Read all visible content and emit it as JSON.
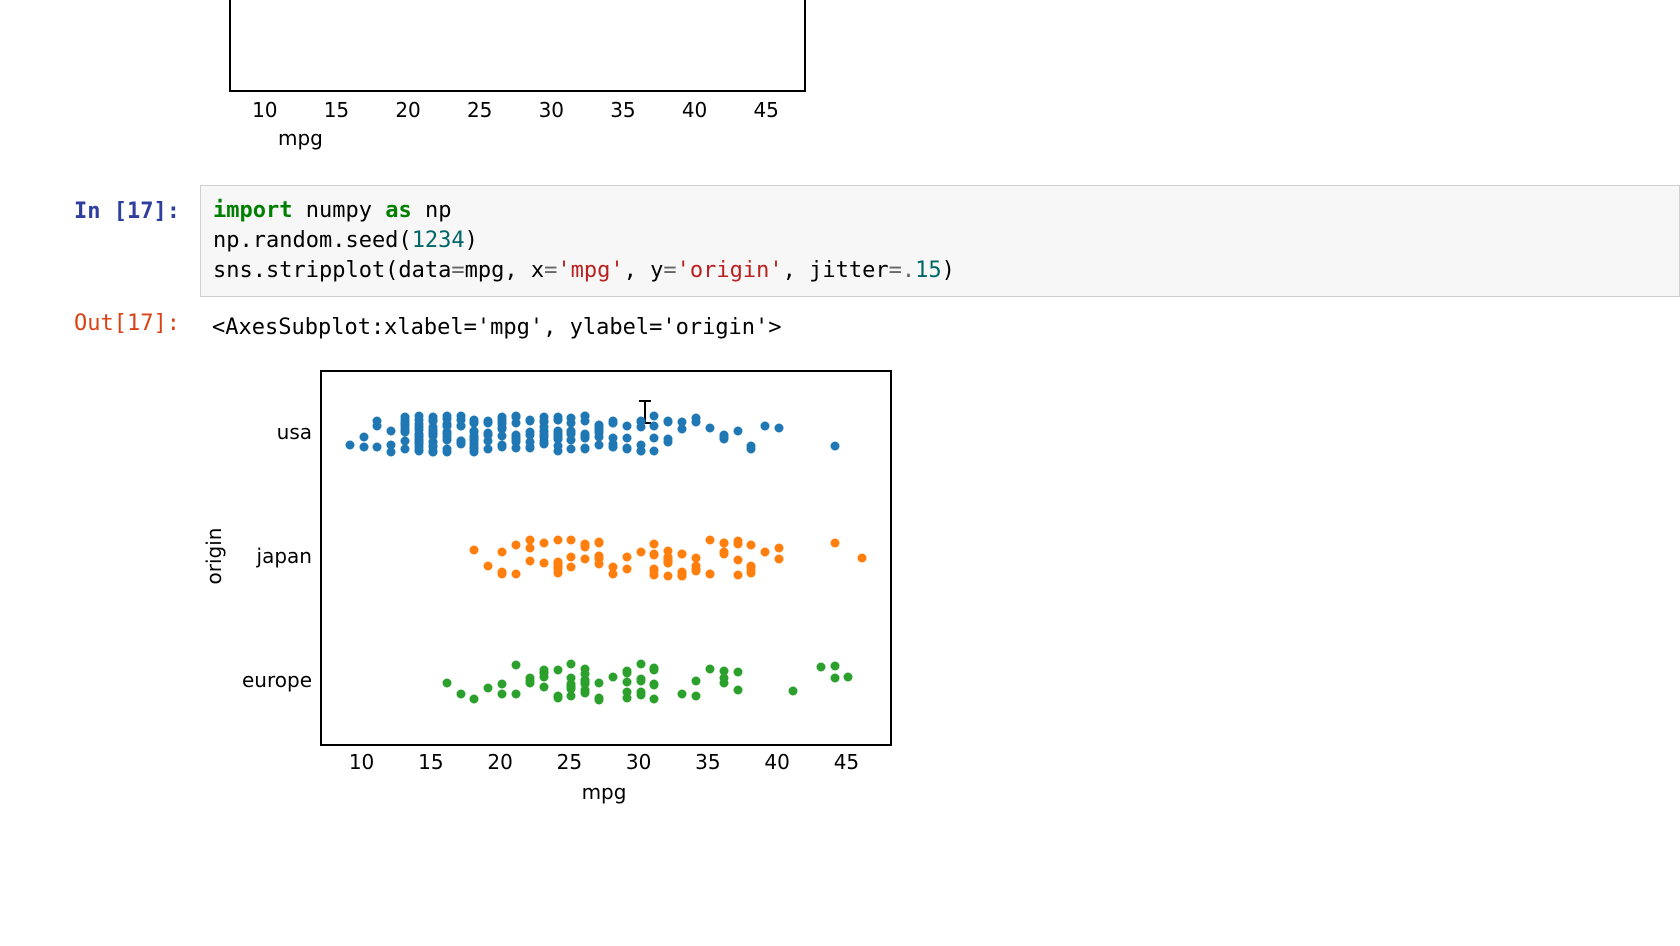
{
  "top_axis": {
    "xlabel": "mpg",
    "xticks": [
      10,
      15,
      20,
      25,
      30,
      35,
      40,
      45
    ]
  },
  "cell": {
    "in_prompt": "In [17]:",
    "out_prompt": "Out[17]:",
    "code_tokens": [
      {
        "t": "import ",
        "c": "k-green"
      },
      {
        "t": "numpy ",
        "c": ""
      },
      {
        "t": "as ",
        "c": "k-green"
      },
      {
        "t": "np",
        "c": ""
      },
      {
        "t": "\n",
        "c": ""
      },
      {
        "t": "np.random.seed(",
        "c": ""
      },
      {
        "t": "1234",
        "c": "k-num"
      },
      {
        "t": ")",
        "c": ""
      },
      {
        "t": "\n",
        "c": ""
      },
      {
        "t": "sns.stripplot(data",
        "c": ""
      },
      {
        "t": "=",
        "c": "k-op"
      },
      {
        "t": "mpg, x",
        "c": ""
      },
      {
        "t": "=",
        "c": "k-op"
      },
      {
        "t": "'mpg'",
        "c": "k-str"
      },
      {
        "t": ", y",
        "c": ""
      },
      {
        "t": "=",
        "c": "k-op"
      },
      {
        "t": "'origin'",
        "c": "k-str"
      },
      {
        "t": ", jitter",
        "c": ""
      },
      {
        "t": "=.",
        "c": "k-op"
      },
      {
        "t": "15",
        "c": "k-num"
      },
      {
        "t": ")",
        "c": ""
      }
    ],
    "out_text": "<AxesSubplot:xlabel='mpg', ylabel='origin'>"
  },
  "chart_data": {
    "type": "strip",
    "xlabel": "mpg",
    "ylabel": "origin",
    "xlim": [
      7,
      48
    ],
    "xticks": [
      10,
      15,
      20,
      25,
      30,
      35,
      40,
      45
    ],
    "categories": [
      "usa",
      "japan",
      "europe"
    ],
    "colors": {
      "usa": "#1f77b4",
      "japan": "#ff7f0e",
      "europe": "#2ca02c"
    },
    "jitter": 0.15,
    "series": [
      {
        "name": "usa",
        "values": [
          18,
          15,
          18,
          16,
          17,
          15,
          14,
          14,
          14,
          15,
          15,
          14,
          15,
          14,
          24,
          22,
          18,
          21,
          27,
          26,
          25,
          24,
          25,
          26,
          21,
          10,
          10,
          11,
          9,
          27,
          28,
          25,
          19,
          16,
          17,
          19,
          18,
          14,
          14,
          14,
          14,
          12,
          13,
          13,
          18,
          22,
          19,
          18,
          23,
          28,
          30,
          30,
          31,
          35,
          27,
          26,
          24,
          25,
          23,
          20,
          21,
          13,
          14,
          15,
          14,
          17,
          11,
          13,
          12,
          13,
          19,
          15,
          13,
          13,
          14,
          18,
          22,
          21,
          26,
          15,
          16,
          29,
          24,
          20,
          19,
          15,
          24,
          20,
          11,
          20,
          19,
          15,
          31,
          26,
          32,
          28,
          24,
          26,
          24,
          26,
          31,
          29,
          24,
          23,
          38,
          36,
          36,
          36,
          34,
          32,
          28,
          26,
          22,
          32,
          28,
          24,
          26,
          22,
          28,
          27,
          13,
          14,
          13,
          14,
          15,
          12,
          13,
          16,
          18,
          18,
          23,
          26,
          22,
          28,
          17,
          21,
          14,
          13,
          15,
          16,
          18,
          21,
          21,
          21,
          21,
          16,
          16,
          18,
          18,
          23,
          24,
          25,
          30,
          33,
          37,
          20,
          18,
          19,
          18,
          15,
          15,
          16,
          15,
          14,
          17,
          16,
          15,
          18,
          21,
          20,
          13,
          29,
          23,
          20,
          23,
          24,
          17,
          15,
          14,
          16,
          24,
          20,
          18,
          27,
          19,
          25,
          36,
          27,
          20,
          19,
          18,
          17,
          30,
          27,
          23,
          40,
          44,
          33,
          30,
          22,
          20,
          17,
          17,
          16,
          18,
          23,
          24,
          25,
          23,
          27,
          30,
          34,
          31,
          29,
          27,
          24,
          23,
          38,
          32,
          39
        ]
      },
      {
        "name": "japan",
        "values": [
          24,
          27,
          25,
          31,
          35,
          24,
          19,
          28,
          23,
          20,
          27,
          18,
          20,
          21,
          22,
          26,
          33,
          20,
          22,
          24,
          32,
          31,
          31,
          32,
          24,
          26,
          29,
          24,
          31,
          24,
          24,
          33,
          33,
          32,
          37,
          32,
          46,
          38,
          36,
          36,
          40,
          38,
          37,
          37,
          34,
          34,
          34,
          38,
          32,
          38,
          25,
          38,
          44,
          27,
          31,
          29,
          24,
          26,
          28,
          39,
          36,
          31,
          35,
          27,
          25,
          23,
          27,
          33,
          33,
          32,
          34,
          37,
          33,
          36,
          30,
          22,
          21,
          26,
          32,
          40,
          35,
          27,
          32,
          34
        ]
      },
      {
        "name": "europe",
        "values": [
          26,
          30,
          25,
          25,
          26,
          27,
          24,
          25,
          23,
          30,
          22,
          18,
          26,
          20,
          29,
          26,
          26,
          31,
          36,
          25,
          24,
          27,
          29,
          23,
          26,
          22,
          20,
          21,
          23,
          24,
          25,
          27,
          25,
          17,
          31,
          36,
          21,
          19,
          25,
          43,
          41,
          44,
          30,
          37,
          34,
          29,
          31,
          31,
          36,
          37,
          28,
          26,
          22,
          33,
          30,
          25,
          23,
          27,
          24,
          16,
          31,
          29,
          45,
          23,
          44,
          34,
          30,
          29,
          35,
          26
        ]
      }
    ]
  }
}
